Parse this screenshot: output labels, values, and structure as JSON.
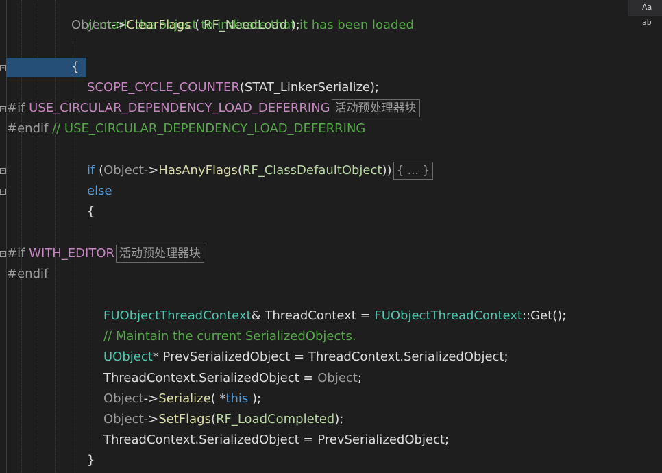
{
  "findbar": {
    "match_case_label": "Aa",
    "extra": "ab"
  },
  "lines": {
    "l1": "// mark the object to indicate that it has been loaded",
    "l2_obj": "Object",
    "l2_arrow": "->",
    "l2_fn": "ClearFlags",
    "l2_open": " ( ",
    "l2_arg": "RF_NeedLoad",
    "l2_close": " );",
    "l3": "{",
    "l4_macro": "SCOPE_CYCLE_COUNTER",
    "l4_arg": "(STAT_LinkerSerialize);",
    "l5_pp": "#if",
    "l5_macro": "USE_CIRCULAR_DEPENDENCY_LOAD_DEFERRING",
    "l5_badge": "活动预处理器块",
    "l6_pp": "#endif",
    "l6_cmt": "// USE_CIRCULAR_DEPENDENCY_LOAD_DEFERRING",
    "l7_if": "if",
    "l7_open": " (",
    "l7_obj": "Object",
    "l7_arrow": "->",
    "l7_fn": "HasAnyFlags",
    "l7_arg_open": "(",
    "l7_arg": "RF_ClassDefaultObject",
    "l7_close": "))",
    "l7_badge": "{ ... }",
    "l8": "else",
    "l9": "{",
    "l10_pp": "#if",
    "l10_macro": "WITH_EDITOR",
    "l10_badge": "活动预处理器块",
    "l11_pp": "#endif",
    "l12_type": "FUObjectThreadContext",
    "l12_rest1": "& ThreadContext = ",
    "l12_type2": "FUObjectThreadContext",
    "l12_rest2": "::Get();",
    "l13": "// Maintain the current SerializedObjects.",
    "l14_type": "UObject",
    "l14_rest": "* PrevSerializedObject = ThreadContext.SerializedObject;",
    "l15_a": "ThreadContext.SerializedObject = ",
    "l15_obj": "Object",
    "l15_end": ";",
    "l16_obj": "Object",
    "l16_arrow": "->",
    "l16_fn": "Serialize",
    "l16_open": "( *",
    "l16_this": "this",
    "l16_close": " );",
    "l17_obj": "Object",
    "l17_arrow": "->",
    "l17_fn": "SetFlags",
    "l17_open": "(",
    "l17_arg": "RF_LoadCompleted",
    "l17_close": ");",
    "l18": "ThreadContext.SerializedObject = PrevSerializedObject;",
    "l19": "}"
  }
}
